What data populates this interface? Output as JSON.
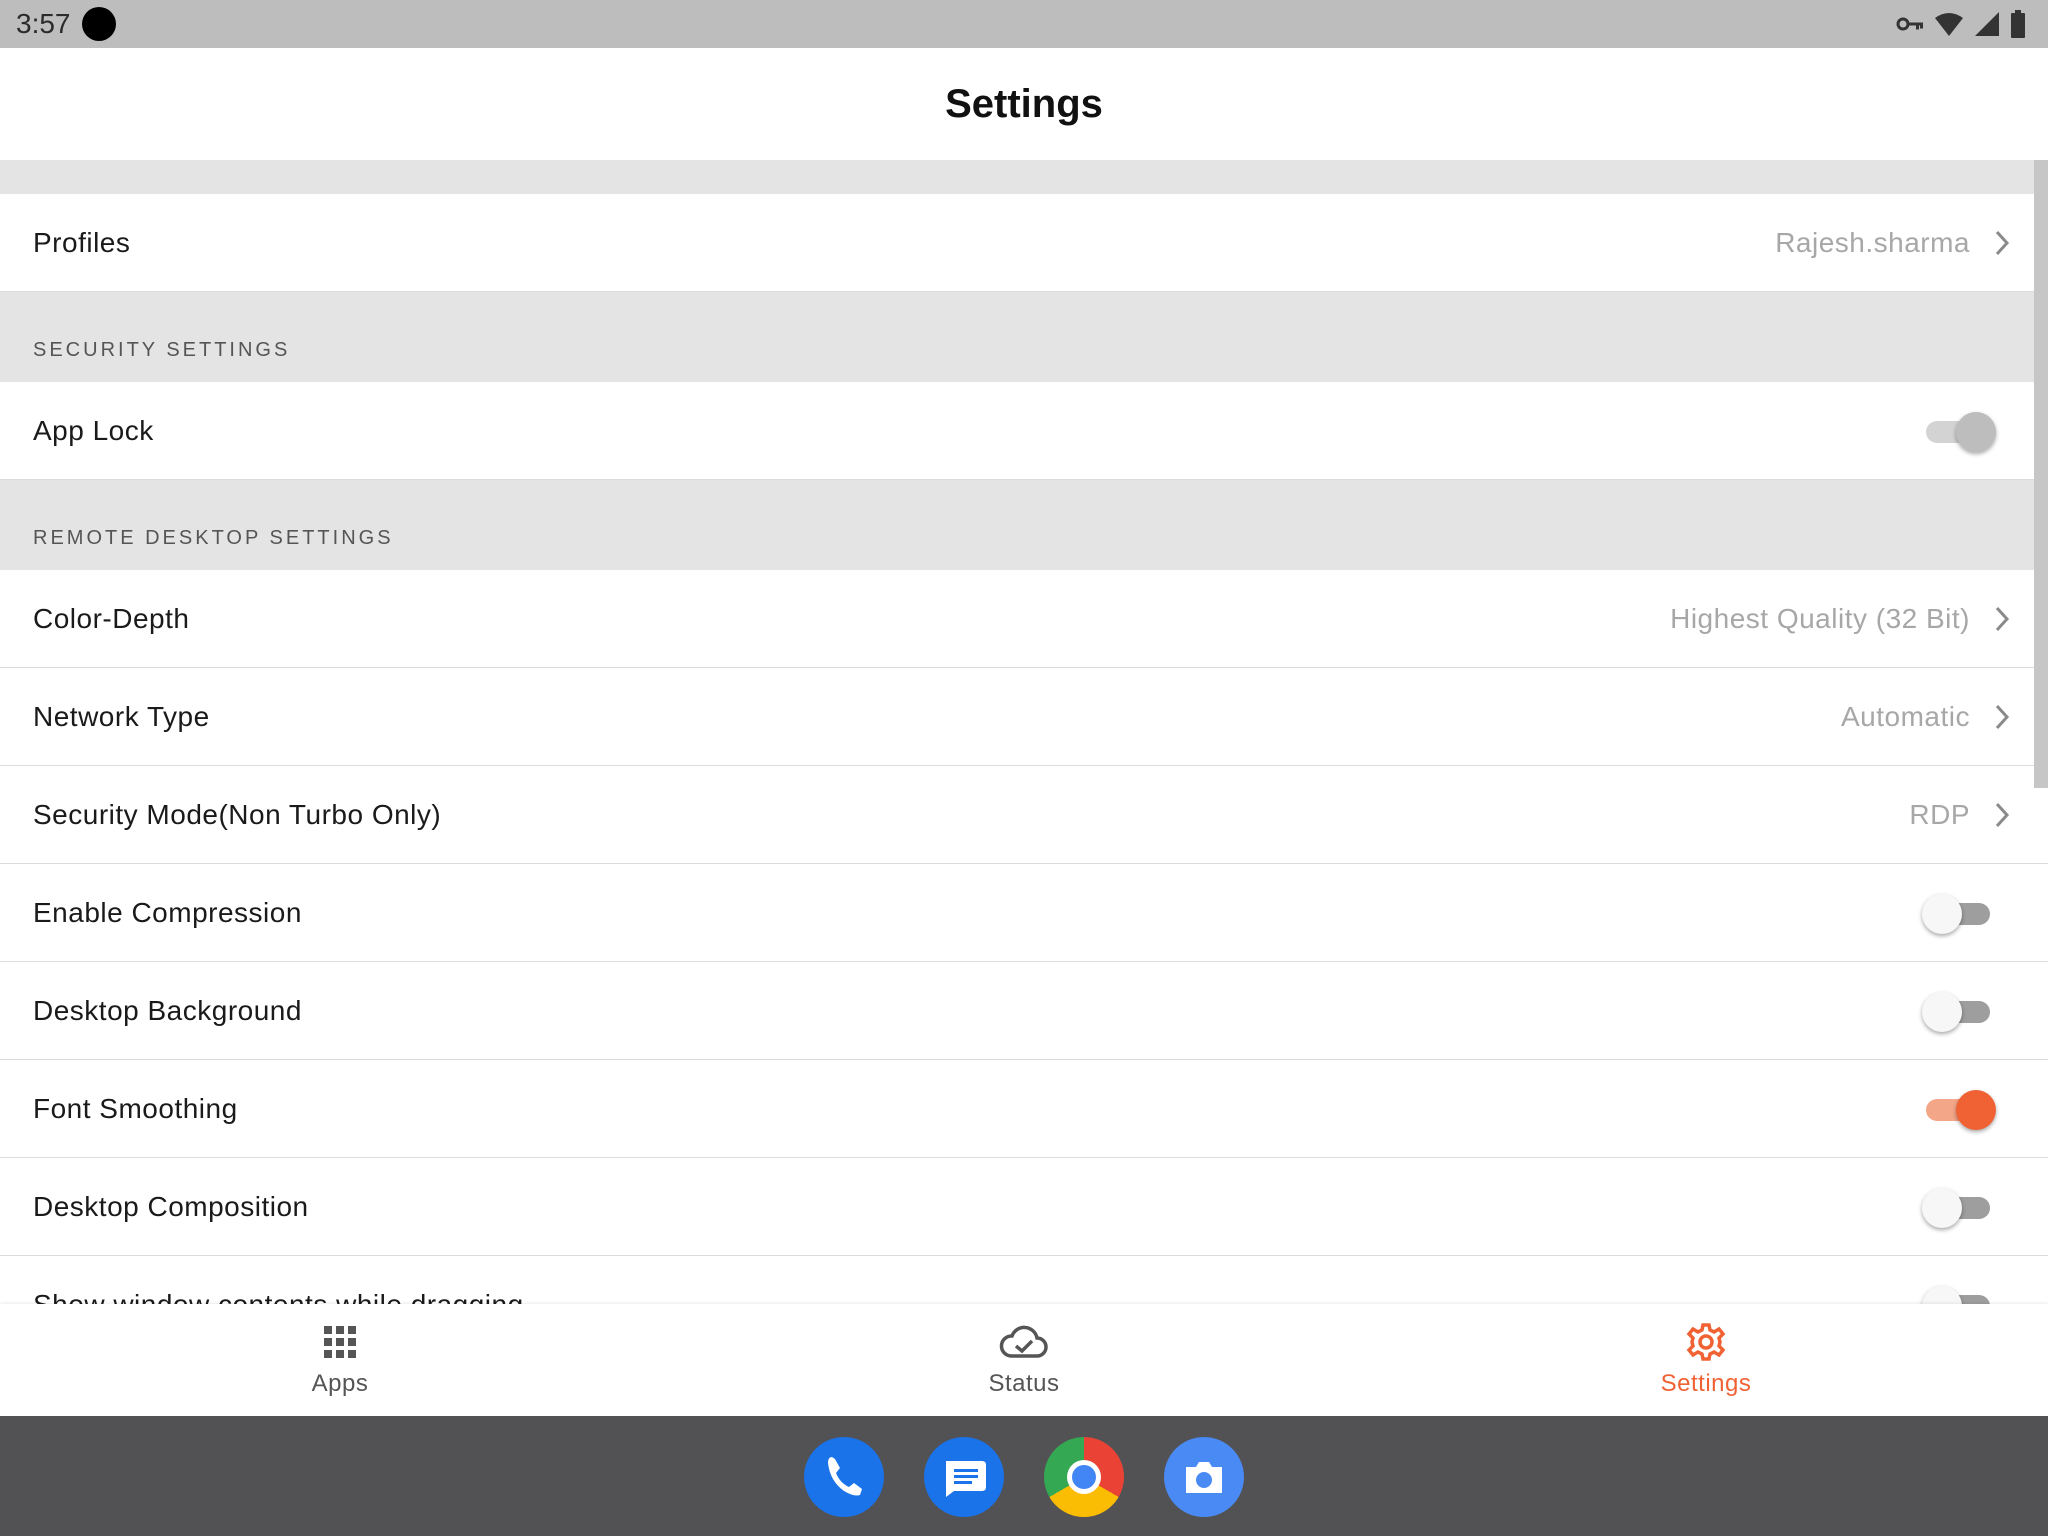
{
  "status_bar": {
    "time": "3:57",
    "icons": [
      "vpn-key-icon",
      "wifi-icon",
      "signal-icon",
      "battery-icon"
    ]
  },
  "app_bar": {
    "title": "Settings"
  },
  "profiles": {
    "label": "Profiles",
    "value": "Rajesh.sharma"
  },
  "security_section": {
    "header": "SECURITY SETTINGS",
    "app_lock": {
      "label": "App Lock",
      "state": "on-disabled"
    }
  },
  "remote_section": {
    "header": "REMOTE DESKTOP SETTINGS",
    "color_depth": {
      "label": "Color-Depth",
      "value": "Highest Quality (32 Bit)"
    },
    "network_type": {
      "label": "Network Type",
      "value": "Automatic"
    },
    "security_mode": {
      "label": "Security Mode(Non Turbo Only)",
      "value": "RDP"
    },
    "enable_compression": {
      "label": "Enable Compression",
      "state": "off"
    },
    "desktop_background": {
      "label": "Desktop Background",
      "state": "off"
    },
    "font_smoothing": {
      "label": "Font Smoothing",
      "state": "on"
    },
    "desktop_composition": {
      "label": "Desktop Composition",
      "state": "off"
    },
    "show_window_contents": {
      "label": "Show window contents while dragging",
      "state": "off"
    }
  },
  "bottom_nav": {
    "apps": "Apps",
    "status": "Status",
    "settings": "Settings",
    "active": "settings"
  },
  "dock": {
    "apps": [
      "phone-app-icon",
      "messages-app-icon",
      "chrome-app-icon",
      "camera-app-icon"
    ]
  },
  "colors": {
    "accent": "#f06233",
    "accent_light": "#f4a688",
    "section_bg": "#e4e4e4",
    "dock_bg": "#525254"
  }
}
